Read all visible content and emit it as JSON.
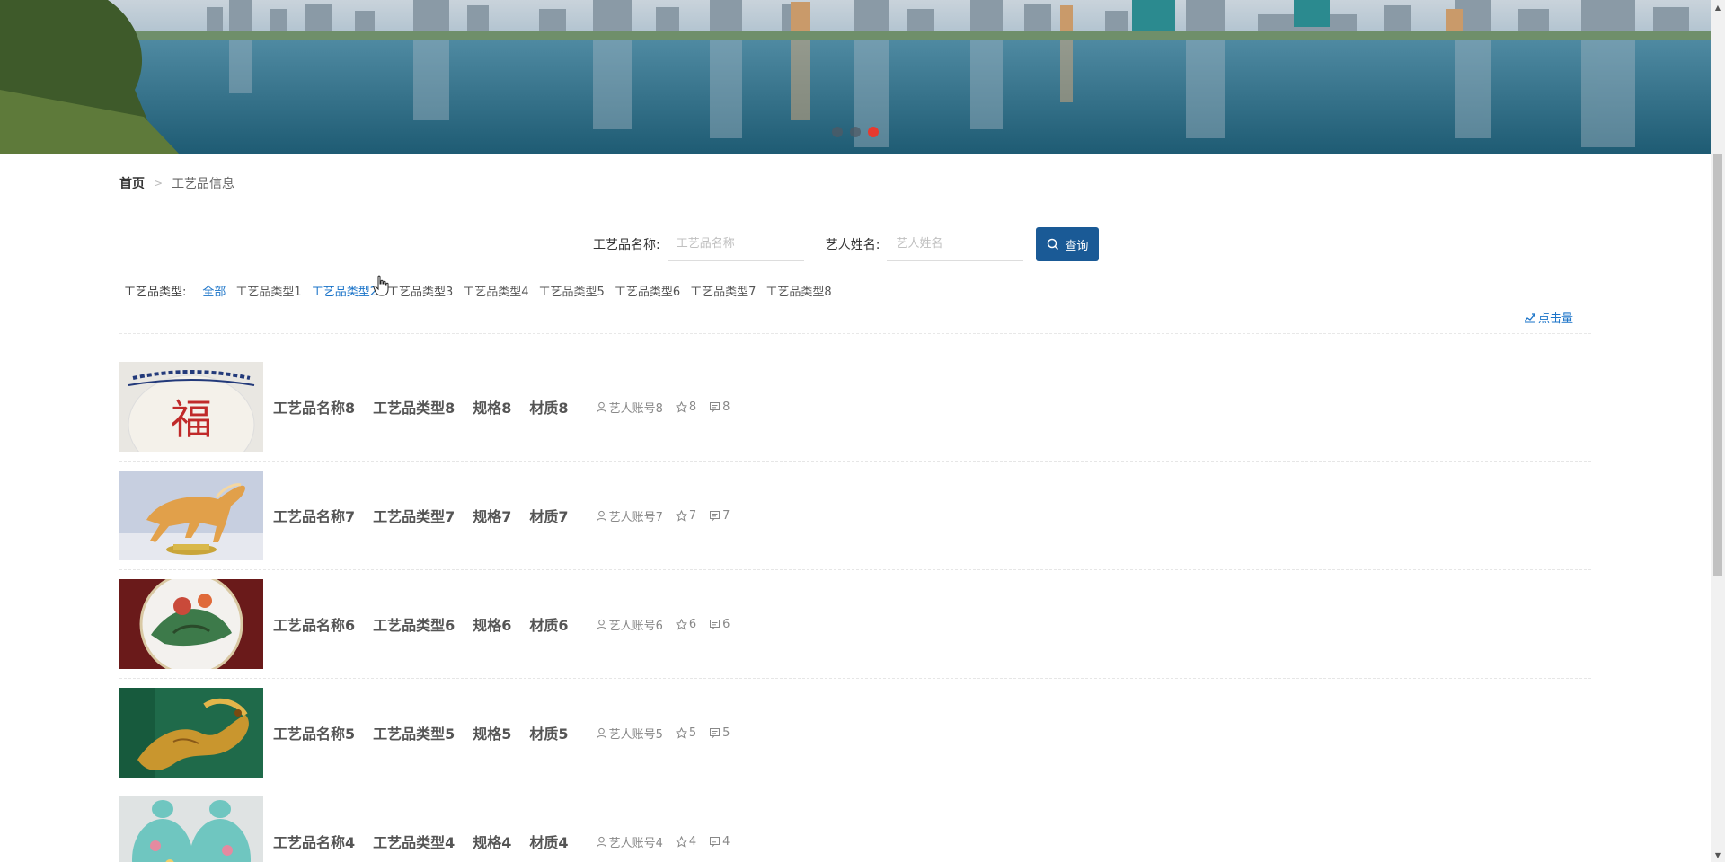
{
  "banner": {
    "dots": [
      {
        "active": false
      },
      {
        "active": false
      },
      {
        "active": true
      }
    ]
  },
  "breadcrumb": {
    "home": "首页",
    "separator": ">",
    "current": "工艺品信息"
  },
  "search": {
    "name_label": "工艺品名称:",
    "name_placeholder": "工艺品名称",
    "artist_label": "艺人姓名:",
    "artist_placeholder": "艺人姓名",
    "button_label": "查询"
  },
  "category": {
    "title": "工艺品类型:",
    "items": [
      {
        "label": "全部",
        "active": true
      },
      {
        "label": "工艺品类型1",
        "active": false
      },
      {
        "label": "工艺品类型2",
        "active": true
      },
      {
        "label": "工艺品类型3",
        "active": false
      },
      {
        "label": "工艺品类型4",
        "active": false
      },
      {
        "label": "工艺品类型5",
        "active": false
      },
      {
        "label": "工艺品类型6",
        "active": false
      },
      {
        "label": "工艺品类型7",
        "active": false
      },
      {
        "label": "工艺品类型8",
        "active": false
      }
    ]
  },
  "sort": {
    "label": "点击量",
    "icon": "trend-chart-icon"
  },
  "items": [
    {
      "name": "工艺品名称8",
      "type": "工艺品类型8",
      "spec": "规格8",
      "material": "材质8",
      "account": "艺人账号8",
      "likes": "8",
      "comments": "8",
      "image": "fu-jar"
    },
    {
      "name": "工艺品名称7",
      "type": "工艺品类型7",
      "spec": "规格7",
      "material": "材质7",
      "account": "艺人账号7",
      "likes": "7",
      "comments": "7",
      "image": "horse-figurine"
    },
    {
      "name": "工艺品名称6",
      "type": "工艺品类型6",
      "spec": "规格6",
      "material": "材质6",
      "account": "艺人账号6",
      "likes": "6",
      "comments": "6",
      "image": "painted-plate"
    },
    {
      "name": "工艺品名称5",
      "type": "工艺品类型5",
      "spec": "规格5",
      "material": "材质5",
      "account": "艺人账号5",
      "likes": "5",
      "comments": "5",
      "image": "golden-dragon"
    },
    {
      "name": "工艺品名称4",
      "type": "工艺品类型4",
      "spec": "规格4",
      "material": "材质4",
      "account": "艺人账号4",
      "likes": "4",
      "comments": "4",
      "image": "blue-vases"
    }
  ],
  "colors": {
    "accent": "#1a73c8",
    "button": "#1a5a96",
    "active_dot": "#e8392f"
  }
}
